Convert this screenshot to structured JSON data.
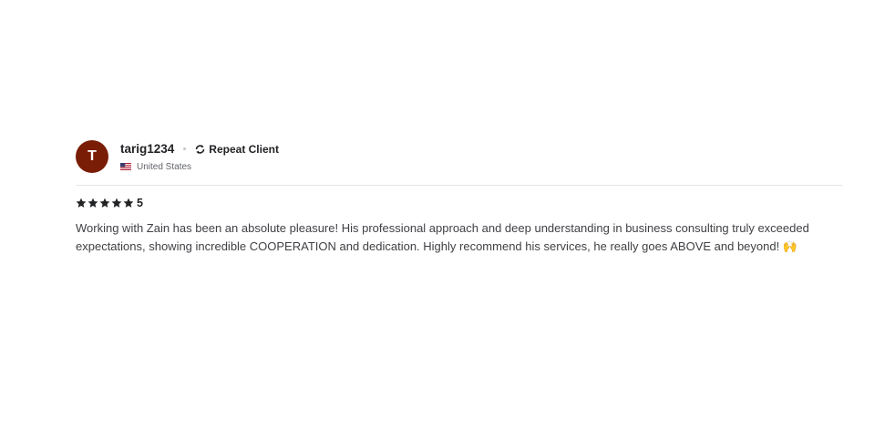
{
  "review": {
    "avatar_letter": "T",
    "username": "tarig1234",
    "badge_label": "Repeat Client",
    "country": "United States",
    "rating_value": "5",
    "stars": 5,
    "text": "Working with Zain has been an absolute pleasure! His professional approach and deep understanding in business consulting truly exceeded expectations, showing incredible COOPERATION and dedication. Highly recommend his services, he really goes ABOVE and beyond! 🙌",
    "icons": {
      "repeat": "repeat-client-icon",
      "flag": "us-flag-icon",
      "star": "star-icon"
    },
    "colors": {
      "avatar_bg": "#7a1d06",
      "text": "#404145",
      "star": "#222325"
    }
  }
}
